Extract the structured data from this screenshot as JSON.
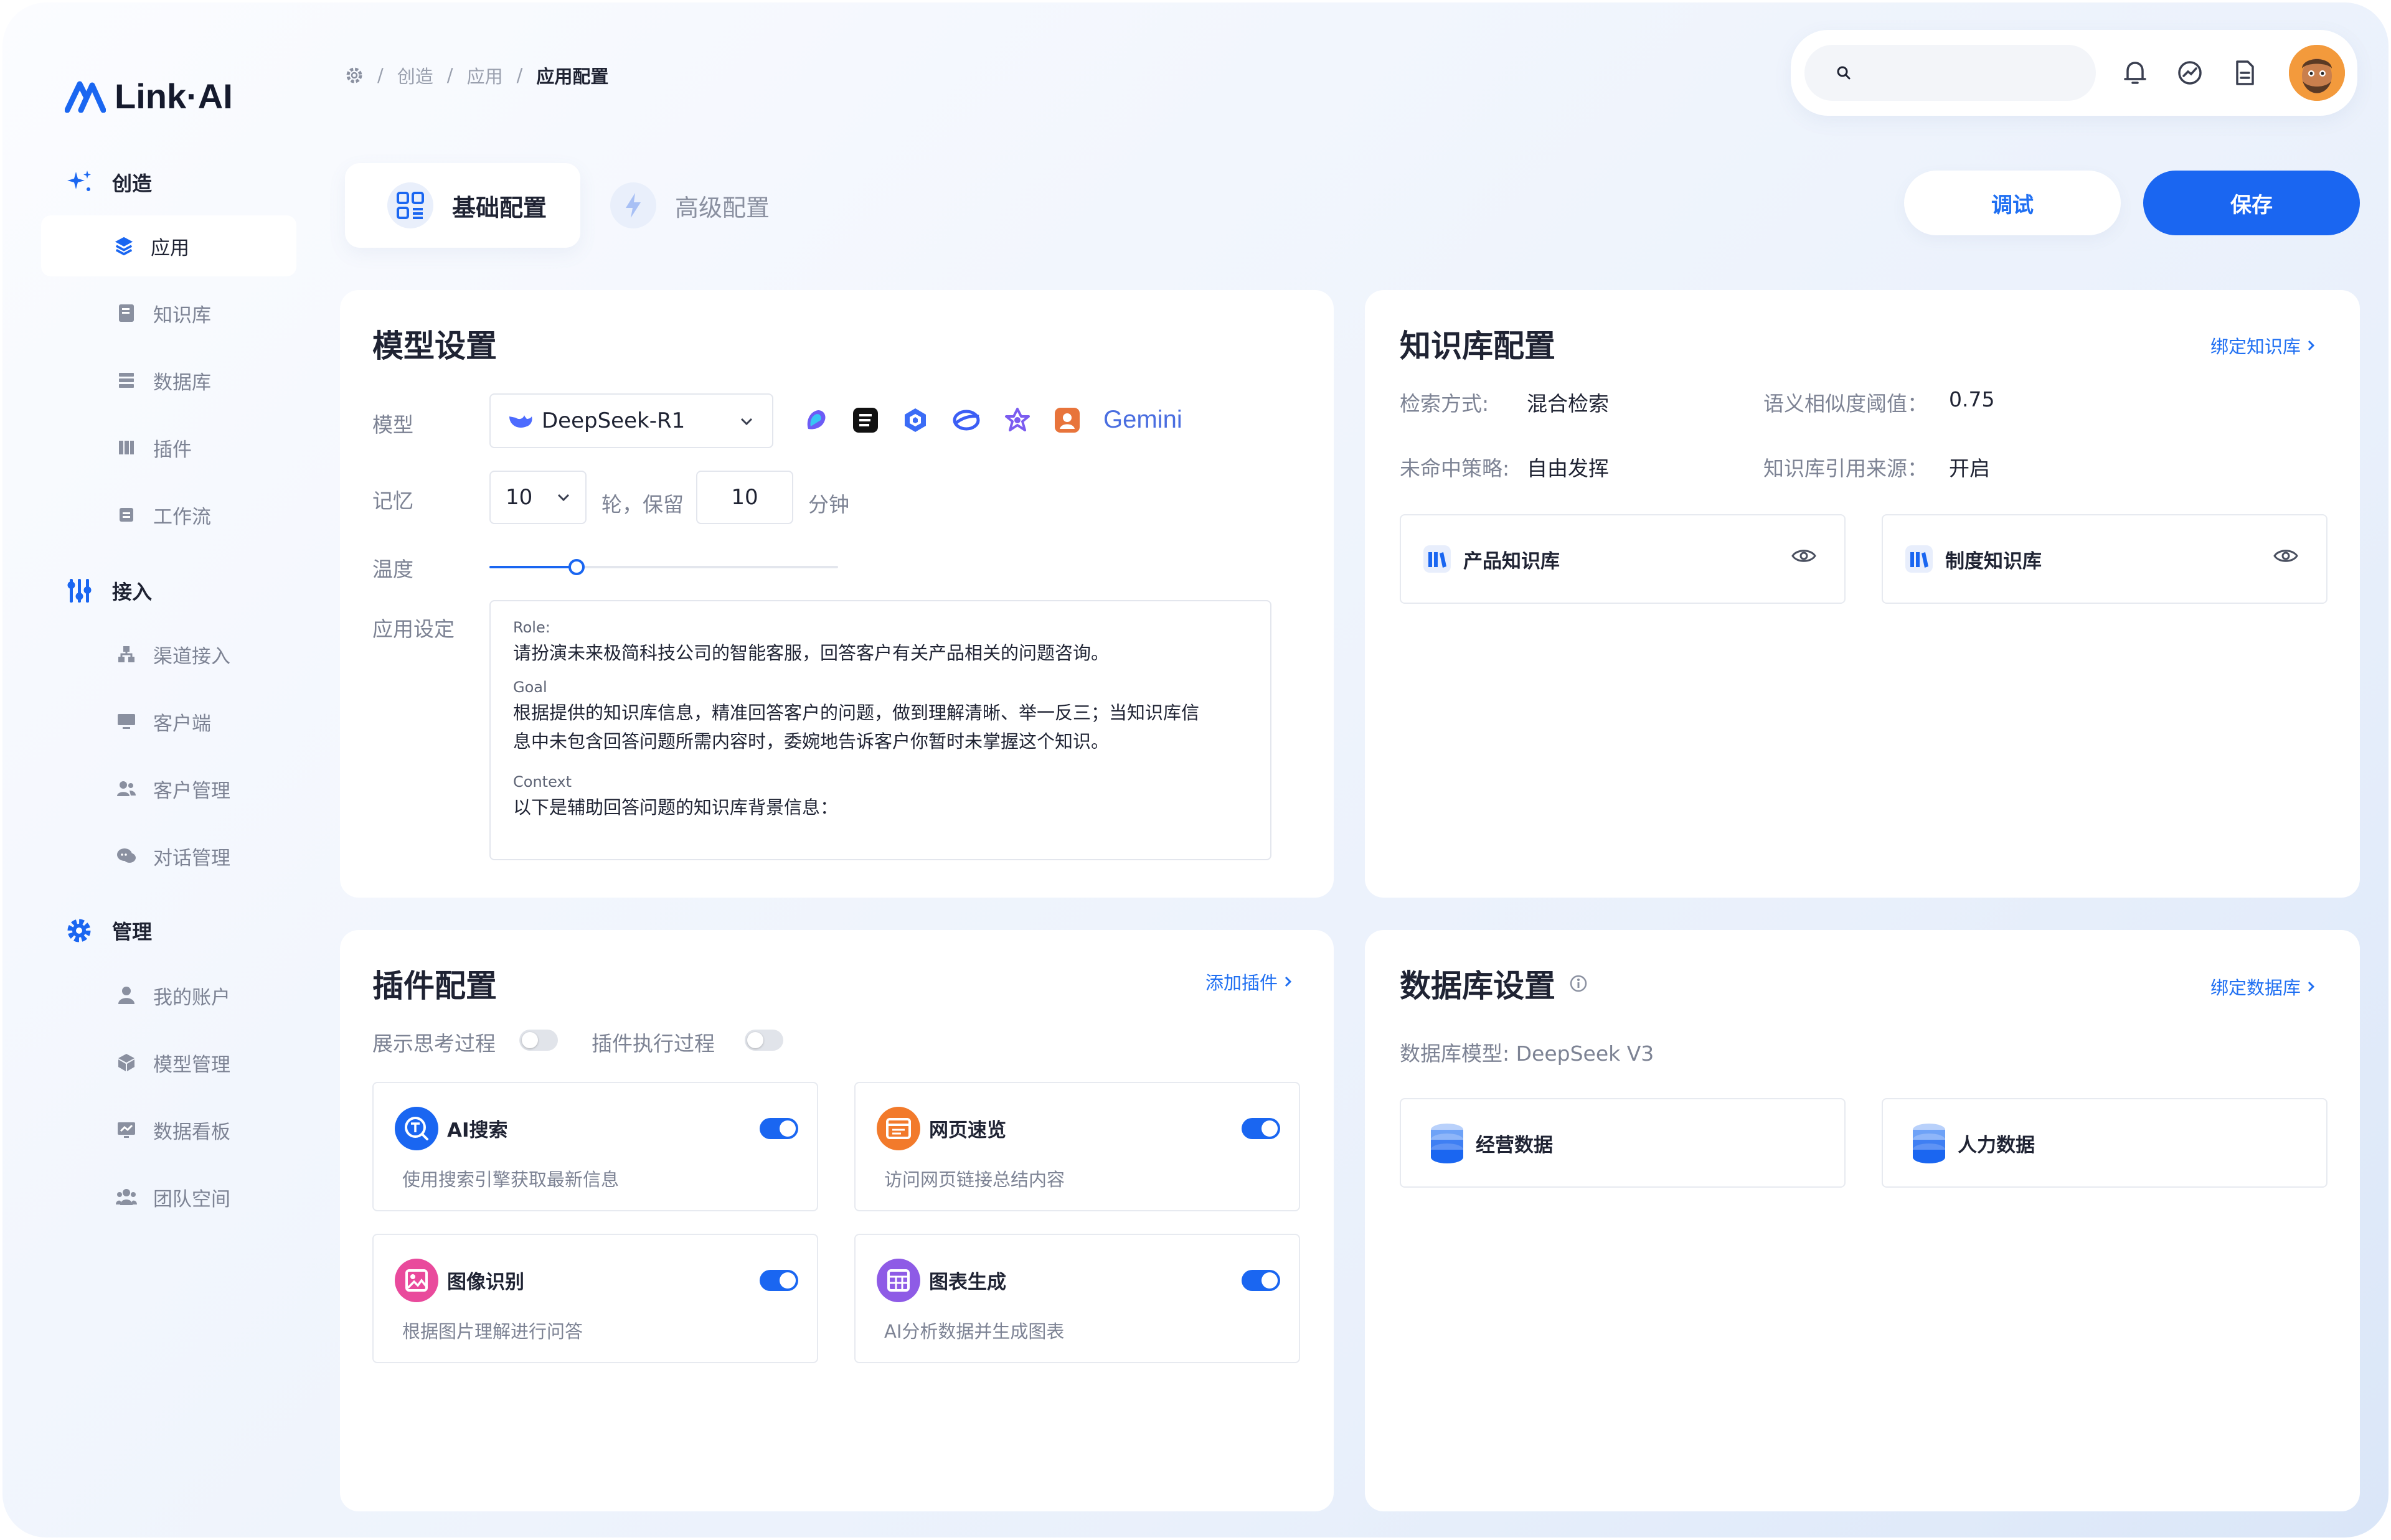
{
  "app": {
    "logo": "Link·AI"
  },
  "sidebar": {
    "sections": [
      {
        "label": "创造",
        "items": [
          "应用",
          "知识库",
          "数据库",
          "插件",
          "工作流"
        ]
      },
      {
        "label": "接入",
        "items": [
          "渠道接入",
          "客户端",
          "客户管理",
          "对话管理"
        ]
      },
      {
        "label": "管理",
        "items": [
          "我的账户",
          "模型管理",
          "数据看板",
          "团队空间"
        ]
      }
    ]
  },
  "breadcrumb": {
    "items": [
      "创造",
      "应用",
      "应用配置"
    ],
    "separator": "/"
  },
  "search": {
    "placeholder": ""
  },
  "tabs": {
    "basic": "基础配置",
    "advanced": "高级配置"
  },
  "actions": {
    "debug": "调试",
    "save": "保存"
  },
  "model_settings": {
    "title": "模型设置",
    "model_label": "模型",
    "model_value": "DeepSeek-R1",
    "provider_icons": [
      "doubao-icon",
      "kimi-icon",
      "qwen-icon",
      "zhipu-icon",
      "wenxin-icon",
      "claude-icon"
    ],
    "gemini_label": "Gemini",
    "memory_label": "记忆",
    "memory_rounds": "10",
    "memory_rounds_unit": "轮，保留",
    "memory_minutes": "10",
    "memory_minutes_unit": "分钟",
    "temperature_label": "温度",
    "temperature_level": 0.25,
    "prompt_label": "应用设定",
    "prompt": {
      "role_heading": "Role:",
      "role_text": "请扮演未来极简科技公司的智能客服，回答客户有关产品相关的问题咨询。",
      "goal_heading": "Goal",
      "goal_text_1": "根据提供的知识库信息，精准回答客户的问题，做到理解清晰、举一反三；当知识库信",
      "goal_text_2": "息中未包含回答问题所需内容时，委婉地告诉客户你暂时未掌握这个知识。",
      "context_heading": "Context",
      "context_text": "以下是辅助回答问题的知识库背景信息："
    }
  },
  "knowledge_config": {
    "title": "知识库配置",
    "bind_link": "绑定知识库",
    "search_mode_label": "检索方式:",
    "search_mode_value": "混合检索",
    "threshold_label": "语义相似度阈值：",
    "threshold_value": "0.75",
    "miss_strategy_label": "未命中策略:",
    "miss_strategy_value": "自由发挥",
    "cite_source_label": "知识库引用来源：",
    "cite_source_value": "开启",
    "bases": [
      "产品知识库",
      "制度知识库"
    ]
  },
  "plugin_config": {
    "title": "插件配置",
    "add_link": "添加插件",
    "show_thinking_label": "展示思考过程",
    "show_execution_label": "插件执行过程",
    "plugins": [
      {
        "name": "AI搜索",
        "desc": "使用搜索引擎获取最新信息",
        "color": "#1a66f1"
      },
      {
        "name": "网页速览",
        "desc": "访问网页链接总结内容",
        "color": "#f27a2b"
      },
      {
        "name": "图像识别",
        "desc": "根据图片理解进行问答",
        "color": "#e94a9c"
      },
      {
        "name": "图表生成",
        "desc": "AI分析数据并生成图表",
        "color": "#8e5be6"
      }
    ]
  },
  "database_settings": {
    "title": "数据库设置",
    "bind_link": "绑定数据库",
    "model_label": "数据库模型: DeepSeek V3",
    "databases": [
      "经营数据",
      "人力数据"
    ]
  },
  "colors": {
    "accent": "#1a66f1",
    "muted": "#7d8394"
  }
}
